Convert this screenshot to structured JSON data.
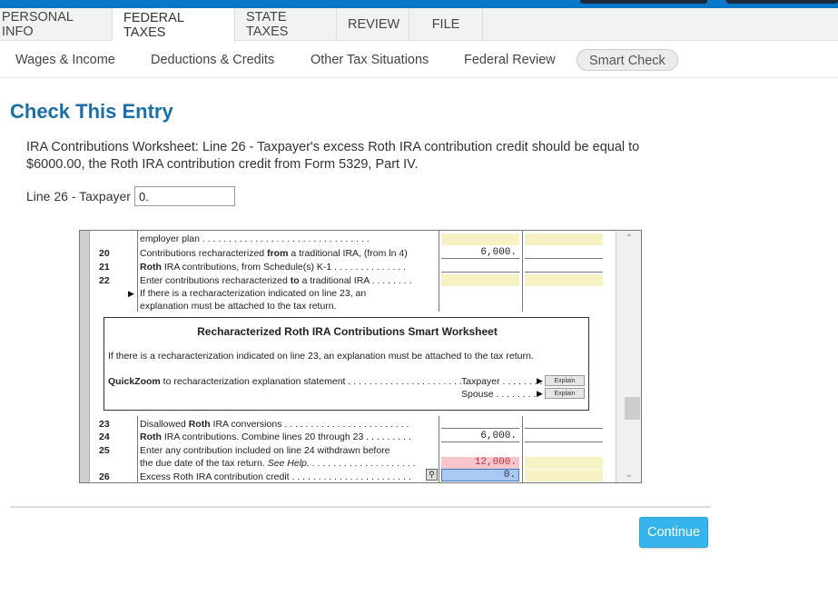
{
  "main_tabs": [
    {
      "label": "PERSONAL INFO"
    },
    {
      "label": "FEDERAL TAXES"
    },
    {
      "label": "STATE TAXES"
    },
    {
      "label": "REVIEW"
    },
    {
      "label": "FILE"
    }
  ],
  "active_main_tab": "FEDERAL TAXES",
  "sub_tabs": [
    {
      "label": "Wages & Income"
    },
    {
      "label": "Deductions & Credits"
    },
    {
      "label": "Other Tax Situations"
    },
    {
      "label": "Federal Review"
    },
    {
      "label": "Smart Check"
    }
  ],
  "active_sub_tab": "Smart Check",
  "page": {
    "title": "Check This Entry",
    "message_line1": "IRA Contributions Worksheet: Line 26 - Taxpayer's excess Roth IRA contribution credit should be equal to",
    "message_line2": "$6000.00, the Roth IRA contribution credit from Form 5329, Part IV.",
    "line_label": "Line 26 - Taxpayer",
    "line_value": "0."
  },
  "form": {
    "row_employer": {
      "text": "employer plan"
    },
    "row20": {
      "num": "20",
      "text_a": "Contributions recharacterized ",
      "text_b": "from",
      "text_c": " a traditional IRA, (from ln 4)",
      "value": "6,000."
    },
    "row21": {
      "num": "21",
      "text_a": "Roth",
      "text_b": " IRA contributions, from Schedule(s) K-1"
    },
    "row22": {
      "num": "22",
      "text_a": "Enter contributions recharacterized ",
      "text_b": "to",
      "text_c": " a traditional IRA"
    },
    "row22_note1": "If there is a recharacterization indicated on line 23, an",
    "row22_note2": "explanation must be attached to the tax return.",
    "smart_worksheet": {
      "title": "Recharacterized Roth IRA Contributions Smart Worksheet",
      "note": "If there is a recharacterization indicated on line 23, an explanation must be attached to the tax return.",
      "quickzoom_bold": "QuickZoom",
      "quickzoom_text": " to recharacterization explanation statement",
      "taxpayer_label": "Taxpayer",
      "spouse_label": "Spouse",
      "explain_label": "Explain"
    },
    "row23": {
      "num": "23",
      "text_a": "Disallowed ",
      "text_b": "Roth",
      "text_c": " IRA conversions"
    },
    "row24": {
      "num": "24",
      "text_a": "Roth",
      "text_b": " IRA contributions. Combine lines 20 through 23",
      "value": "6,000."
    },
    "row25": {
      "num": "25",
      "text_a": "Enter any contribution included on line 24 withdrawn before"
    },
    "row25b": {
      "text_a": "the due date of the tax return. ",
      "text_b": "See Help.",
      "value": "12,000."
    },
    "row26": {
      "num": "26",
      "text_a": "Excess Roth IRA contribution credit",
      "value": "0."
    }
  },
  "continue_label": "Continue",
  "colors": {
    "accent": "#1a6fa8",
    "button": "#35b5ec",
    "topbar": "#0a77c8"
  }
}
